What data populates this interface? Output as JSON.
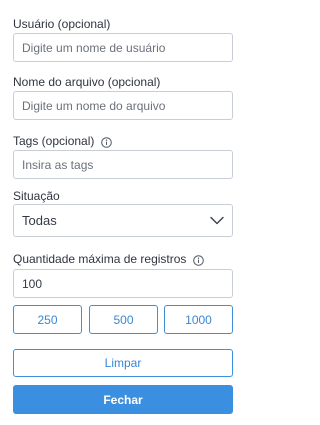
{
  "filters": {
    "username": {
      "label": "Usuário (opcional)",
      "placeholder": "Digite um nome de usuário",
      "value": ""
    },
    "filename": {
      "label": "Nome do arquivo (opcional)",
      "placeholder": "Digite um nome do arquivo",
      "value": ""
    },
    "tags": {
      "label": "Tags (opcional)",
      "placeholder": "Insira as tags",
      "value": "",
      "info_icon": "info-icon"
    },
    "status": {
      "label": "Situação",
      "selected": "Todas",
      "dropdown_icon": "chevron-down-icon"
    },
    "max_records": {
      "label": "Quantidade máxima de registros",
      "value": "100",
      "info_icon": "info-icon",
      "presets": [
        "250",
        "500",
        "1000"
      ]
    }
  },
  "actions": {
    "clear_label": "Limpar",
    "close_label": "Fechar"
  },
  "colors": {
    "accent": "#3b8fe0",
    "border": "#c9ced6",
    "text": "#333a45",
    "placeholder": "#6b717c"
  }
}
